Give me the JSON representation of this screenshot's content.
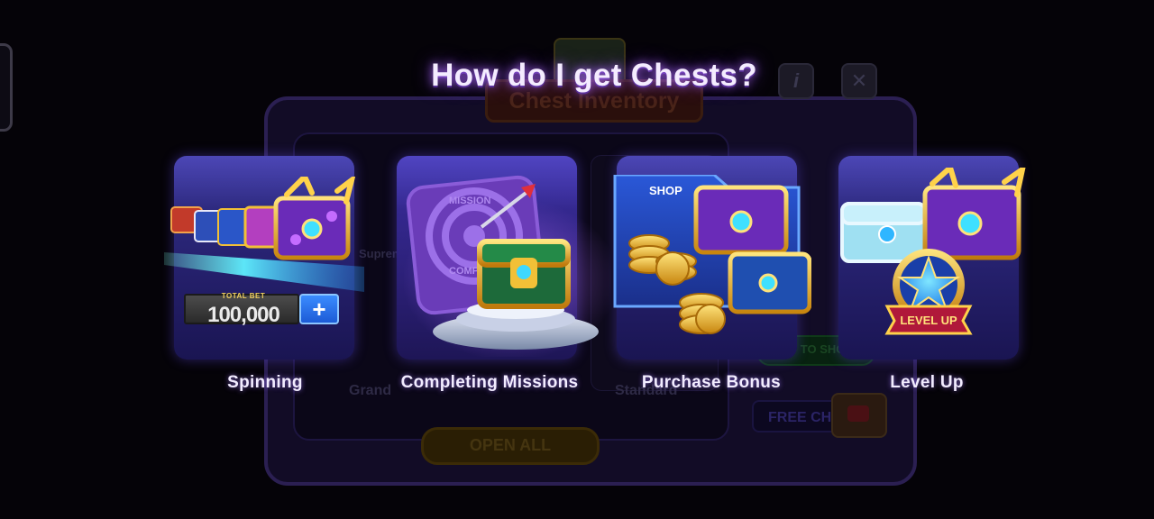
{
  "background": {
    "title": "Chest Inventory",
    "labels": [
      "Grand",
      "Supreme",
      "Standard"
    ],
    "open_all": "OPEN ALL",
    "go_to_shop": "GO TO SHOP",
    "free_chest": "FREE CH",
    "info_icon_glyph": "i",
    "close_icon_glyph": "✕"
  },
  "popup": {
    "title": "How do I get Chests?",
    "cards": [
      {
        "label": "Spinning",
        "icon": "chest-stack-icon"
      },
      {
        "label": "Completing Missions",
        "icon": "mission-chest-icon"
      },
      {
        "label": "Purchase Bonus",
        "icon": "shop-chest-icon"
      },
      {
        "label": "Level Up",
        "icon": "level-up-chest-icon"
      }
    ],
    "spinning": {
      "total_bet_caption": "TOTAL BET",
      "bet_value": "100,000",
      "plus_glyph": "+"
    },
    "missions": {
      "target_text": "MISSION",
      "target_text_2": "COMP"
    },
    "shop": {
      "shop_tag": "SHOP"
    },
    "level_up": {
      "badge_text": "LEVEL UP"
    }
  },
  "colors": {
    "card_bg": "#2a2580",
    "title_glow": "#a46cff",
    "gold": "#f2c037",
    "accent_blue": "#3b8cff"
  }
}
